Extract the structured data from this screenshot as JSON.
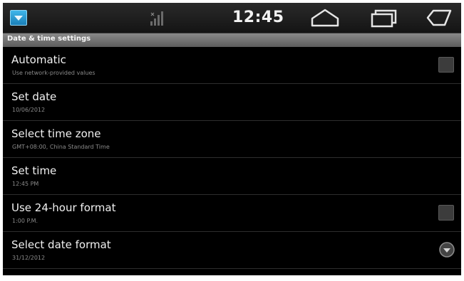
{
  "status_bar": {
    "time": "12:45",
    "icons": [
      "app-notification-icon",
      "signal-icon",
      "home-icon",
      "recent-apps-icon",
      "back-icon"
    ]
  },
  "header": {
    "title": "Date & time settings"
  },
  "settings": [
    {
      "title": "Automatic",
      "summary": "Use network-provided values",
      "control": "checkbox",
      "checked": false
    },
    {
      "title": "Set date",
      "summary": "10/06/2012"
    },
    {
      "title": "Select time zone",
      "summary": "GMT+08:00, China Standard Time"
    },
    {
      "title": "Set time",
      "summary": "12:45 PM"
    },
    {
      "title": "Use 24-hour format",
      "summary": "1:00 P.M.",
      "control": "checkbox",
      "checked": false
    },
    {
      "title": "Select date format",
      "summary": "31/12/2012",
      "control": "dropdown"
    }
  ],
  "colors": {
    "background": "#000000",
    "header": "#6e6e6e",
    "title_text": "#f1f1f1",
    "summary_text": "#8a8a8a",
    "accent": "#2a9fd8"
  }
}
